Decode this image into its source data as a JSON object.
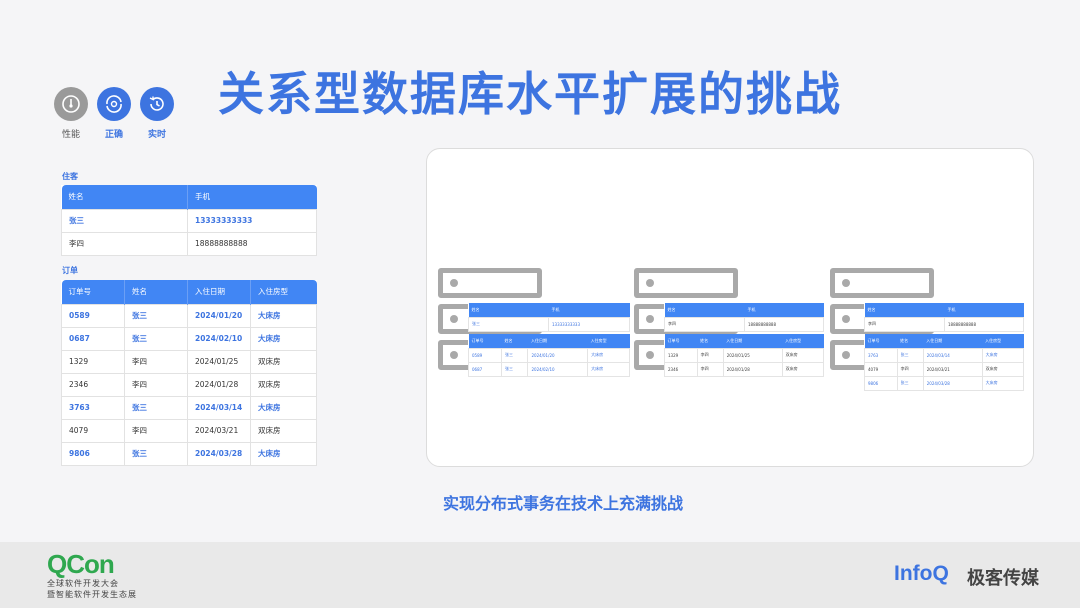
{
  "title": "关系型数据库水平扩展的挑战",
  "attributes": [
    {
      "label": "性能",
      "icon": "performance-icon",
      "color": "#9a9a9a"
    },
    {
      "label": "正确",
      "icon": "correctness-icon",
      "color": "#3d74e0"
    },
    {
      "label": "实时",
      "icon": "realtime-icon",
      "color": "#3d74e0"
    }
  ],
  "guests": {
    "label": "住客",
    "columns": [
      "姓名",
      "手机"
    ],
    "rows": [
      {
        "name": "张三",
        "phone": "13333333333",
        "highlight": true
      },
      {
        "name": "李四",
        "phone": "18888888888",
        "highlight": false
      }
    ]
  },
  "orders": {
    "label": "订单",
    "columns": [
      "订单号",
      "姓名",
      "入住日期",
      "入住房型"
    ],
    "rows": [
      {
        "id": "0589",
        "name": "张三",
        "date": "2024/01/20",
        "room": "大床房",
        "highlight": true
      },
      {
        "id": "0687",
        "name": "张三",
        "date": "2024/02/10",
        "room": "大床房",
        "highlight": true
      },
      {
        "id": "1329",
        "name": "李四",
        "date": "2024/01/25",
        "room": "双床房",
        "highlight": false
      },
      {
        "id": "2346",
        "name": "李四",
        "date": "2024/01/28",
        "room": "双床房",
        "highlight": false
      },
      {
        "id": "3763",
        "name": "张三",
        "date": "2024/03/14",
        "room": "大床房",
        "highlight": true
      },
      {
        "id": "4079",
        "name": "李四",
        "date": "2024/03/21",
        "room": "双床房",
        "highlight": false
      },
      {
        "id": "9806",
        "name": "张三",
        "date": "2024/03/28",
        "room": "大床房",
        "highlight": true
      }
    ]
  },
  "shards": [
    {
      "guests": [
        {
          "name": "张三",
          "phone": "13333333333",
          "highlight": true
        }
      ],
      "orders": [
        {
          "id": "0589",
          "name": "张三",
          "date": "2024/01/20",
          "room": "大床房",
          "highlight": true
        },
        {
          "id": "0687",
          "name": "张三",
          "date": "2024/02/10",
          "room": "大床房",
          "highlight": true
        }
      ]
    },
    {
      "guests": [
        {
          "name": "李四",
          "phone": "18888888888",
          "highlight": false
        }
      ],
      "orders": [
        {
          "id": "1329",
          "name": "李四",
          "date": "2024/01/25",
          "room": "双床房",
          "highlight": false
        },
        {
          "id": "2346",
          "name": "李四",
          "date": "2024/01/28",
          "room": "双床房",
          "highlight": false
        }
      ]
    },
    {
      "guests": [
        {
          "name": "李四",
          "phone": "18888888888",
          "highlight": false
        }
      ],
      "orders": [
        {
          "id": "3763",
          "name": "张三",
          "date": "2024/03/14",
          "room": "大床房",
          "highlight": true
        },
        {
          "id": "4079",
          "name": "李四",
          "date": "2024/03/21",
          "room": "双床房",
          "highlight": false
        },
        {
          "id": "9806",
          "name": "张三",
          "date": "2024/03/28",
          "room": "大床房",
          "highlight": true
        }
      ]
    }
  ],
  "caption": "实现分布式事务在技术上充满挑战",
  "footer": {
    "qcon": "QCon",
    "qcon_line1": "全球软件开发大会",
    "qcon_line2": "暨智能软件开发生态展",
    "infoq": "InfoQ",
    "infoq_cn": "极客传媒"
  }
}
